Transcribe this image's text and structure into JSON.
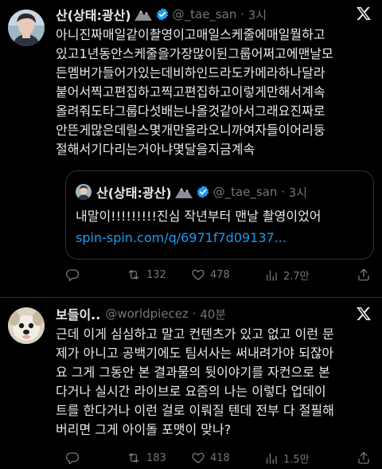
{
  "tweet1": {
    "name": "산(상태:광산)",
    "handle": "@_tae_san",
    "time": "3시",
    "body_lines": [
      "아니진짜매일같이촬영이고매일스케줄에매일뭘하고",
      "있고1년동안스케줄을가장많이뒨그룹어쩌고에맨날모",
      "든멤버가들어가있는데비하인드라도카메라하나달라",
      "붙어서찍고편집하고찍고편집하고이렇게만해서계속",
      "올려줘도타그룹다섯배는나올것같아서그래요진짜로",
      "안뜬게많은데릴스몇개만올라오니까여자들이어리둥",
      "절해서기다리는거아냐몇달을지금계속"
    ],
    "quote": {
      "name": "산(상태:광산)",
      "handle": "@_tae_san",
      "time": "3시",
      "text": "내말이!!!!!!!!!진심 작년부터 맨날 촬영이었어",
      "link": "spin-spin.com/q/6971f7d09137..."
    },
    "retweets": "132",
    "likes": "478",
    "views": "2.7만"
  },
  "tweet2": {
    "name": "보들이..",
    "handle": "@worldpiecez",
    "time": "40분",
    "body_lines": [
      "근데 이게 심심하고 말고 컨텐츠가 있고 없고 이런 문",
      "제가 아니고 공백기에도 팀서사는 써내려가야 되잖아",
      "요 그게 그동안 본 결과물의 뒷이야기를 자컨으로 본",
      "다거나 실시간 라이브로 요즘의 나는 이렇다 업데이",
      "트를 한다거나 이런 걸로 이뤄질 텐데 전부 다 절필해",
      "버리면 그게 아이돌 포맷이 맞나?"
    ],
    "retweets": "183",
    "likes": "418",
    "views": "1.5만"
  },
  "icons": {
    "reply": "reply-icon",
    "retweet": "retweet-icon",
    "like": "heart-icon",
    "views": "views-icon",
    "share": "share-icon",
    "verified": "verified-badge-icon",
    "x": "x-logo-icon"
  },
  "colors": {
    "background": "#000000",
    "text": "#e7e9ea",
    "muted": "#71767b",
    "link": "#1d9bf0",
    "verified": "#1d9bf0",
    "divider": "#2f3336"
  }
}
